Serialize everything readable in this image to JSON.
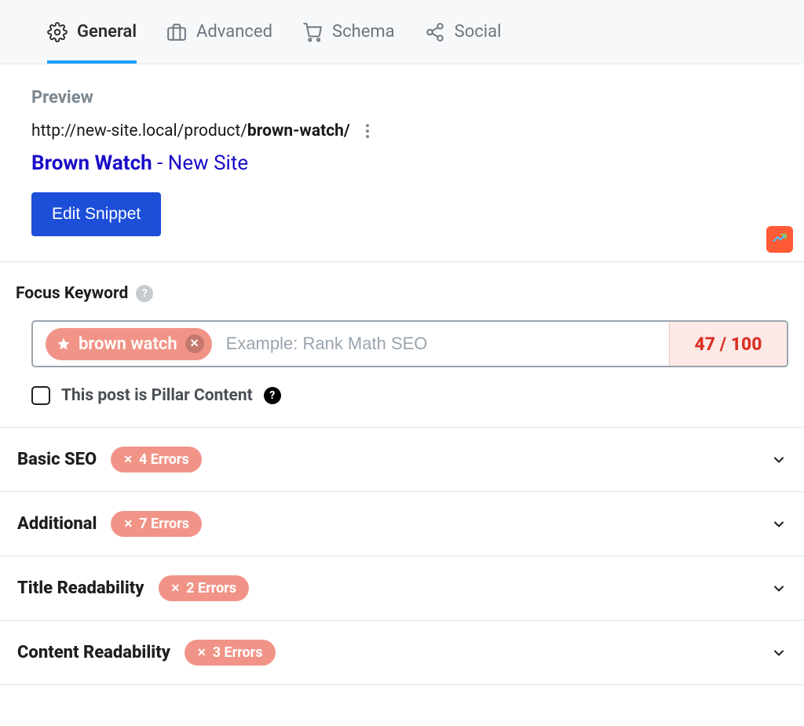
{
  "tabs": {
    "general": "General",
    "advanced": "Advanced",
    "schema": "Schema",
    "social": "Social",
    "activeIndex": 0
  },
  "preview": {
    "label": "Preview",
    "url_prefix": "http://new-site.local/product/",
    "url_slug": "brown-watch/",
    "title_strong": "Brown Watch",
    "title_sep": " - ",
    "title_rest": "New Site",
    "edit_snippet": "Edit Snippet"
  },
  "focus_keyword": {
    "label": "Focus Keyword",
    "chip": "brown watch",
    "placeholder": "Example: Rank Math SEO",
    "score": "47 / 100"
  },
  "pillar": {
    "label": "This post is Pillar Content",
    "checked": false
  },
  "sections": [
    {
      "title": "Basic SEO",
      "errors": "4 Errors"
    },
    {
      "title": "Additional",
      "errors": "7 Errors"
    },
    {
      "title": "Title Readability",
      "errors": "2 Errors"
    },
    {
      "title": "Content Readability",
      "errors": "3 Errors"
    }
  ]
}
